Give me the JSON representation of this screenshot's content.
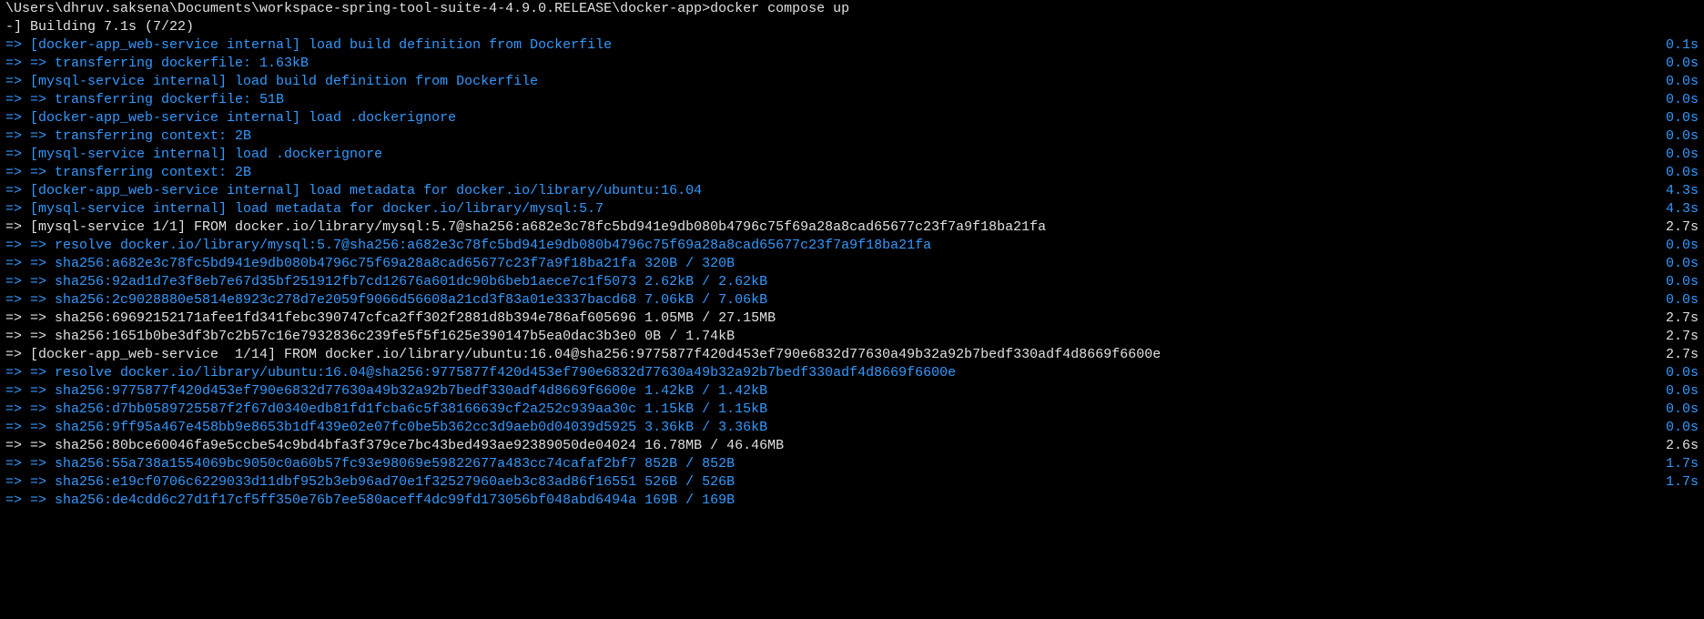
{
  "prompt_line": "\\Users\\dhruv.saksena\\Documents\\workspace-spring-tool-suite-4-4.9.0.RELEASE\\docker-app>docker compose up",
  "building_line": "-] Building 7.1s (7/22)",
  "lines": [
    {
      "color": "blue",
      "left": "=> [docker-app_web-service internal] load build definition from Dockerfile",
      "right": "0.1s"
    },
    {
      "color": "blue",
      "left": "=> => transferring dockerfile: 1.63kB",
      "right": "0.0s"
    },
    {
      "color": "blue",
      "left": "=> [mysql-service internal] load build definition from Dockerfile",
      "right": "0.0s"
    },
    {
      "color": "blue",
      "left": "=> => transferring dockerfile: 51B",
      "right": "0.0s"
    },
    {
      "color": "blue",
      "left": "=> [docker-app_web-service internal] load .dockerignore",
      "right": "0.0s"
    },
    {
      "color": "blue",
      "left": "=> => transferring context: 2B",
      "right": "0.0s"
    },
    {
      "color": "blue",
      "left": "=> [mysql-service internal] load .dockerignore",
      "right": "0.0s"
    },
    {
      "color": "blue",
      "left": "=> => transferring context: 2B",
      "right": "0.0s"
    },
    {
      "color": "blue",
      "left": "=> [docker-app_web-service internal] load metadata for docker.io/library/ubuntu:16.04",
      "right": "4.3s"
    },
    {
      "color": "blue",
      "left": "=> [mysql-service internal] load metadata for docker.io/library/mysql:5.7",
      "right": "4.3s"
    },
    {
      "color": "white",
      "left": "=> [mysql-service 1/1] FROM docker.io/library/mysql:5.7@sha256:a682e3c78fc5bd941e9db080b4796c75f69a28a8cad65677c23f7a9f18ba21fa",
      "right": "2.7s"
    },
    {
      "color": "blue",
      "left": "=> => resolve docker.io/library/mysql:5.7@sha256:a682e3c78fc5bd941e9db080b4796c75f69a28a8cad65677c23f7a9f18ba21fa",
      "right": "0.0s"
    },
    {
      "color": "blue",
      "left": "=> => sha256:a682e3c78fc5bd941e9db080b4796c75f69a28a8cad65677c23f7a9f18ba21fa 320B / 320B",
      "right": "0.0s"
    },
    {
      "color": "blue",
      "left": "=> => sha256:92ad1d7e3f8eb7e67d35bf251912fb7cd12676a601dc90b6beb1aece7c1f5073 2.62kB / 2.62kB",
      "right": "0.0s"
    },
    {
      "color": "blue",
      "left": "=> => sha256:2c9028880e5814e8923c278d7e2059f9066d56608a21cd3f83a01e3337bacd68 7.06kB / 7.06kB",
      "right": "0.0s"
    },
    {
      "color": "white",
      "left": "=> => sha256:69692152171afee1fd341febc390747cfca2ff302f2881d8b394e786af605696 1.05MB / 27.15MB",
      "right": "2.7s"
    },
    {
      "color": "white",
      "left": "=> => sha256:1651b0be3df3b7c2b57c16e7932836c239fe5f5f1625e390147b5ea0dac3b3e0 0B / 1.74kB",
      "right": "2.7s"
    },
    {
      "color": "white",
      "left": "=> [docker-app_web-service  1/14] FROM docker.io/library/ubuntu:16.04@sha256:9775877f420d453ef790e6832d77630a49b32a92b7bedf330adf4d8669f6600e",
      "right": "2.7s"
    },
    {
      "color": "blue",
      "left": "=> => resolve docker.io/library/ubuntu:16.04@sha256:9775877f420d453ef790e6832d77630a49b32a92b7bedf330adf4d8669f6600e",
      "right": "0.0s"
    },
    {
      "color": "blue",
      "left": "=> => sha256:9775877f420d453ef790e6832d77630a49b32a92b7bedf330adf4d8669f6600e 1.42kB / 1.42kB",
      "right": "0.0s"
    },
    {
      "color": "blue",
      "left": "=> => sha256:d7bb0589725587f2f67d0340edb81fd1fcba6c5f38166639cf2a252c939aa30c 1.15kB / 1.15kB",
      "right": "0.0s"
    },
    {
      "color": "blue",
      "left": "=> => sha256:9ff95a467e458bb9e8653b1df439e02e07fc0be5b362cc3d9aeb0d04039d5925 3.36kB / 3.36kB",
      "right": "0.0s"
    },
    {
      "color": "white",
      "left": "=> => sha256:80bce60046fa9e5ccbe54c9bd4bfa3f379ce7bc43bed493ae92389050de04024 16.78MB / 46.46MB",
      "right": "2.6s"
    },
    {
      "color": "blue",
      "left": "=> => sha256:55a738a1554069bc9050c0a60b57fc93e98069e59822677a483cc74cafaf2bf7 852B / 852B",
      "right": "1.7s"
    },
    {
      "color": "blue",
      "left": "=> => sha256:e19cf0706c6229033d11dbf952b3eb96ad70e1f32527960aeb3c83ad86f16551 526B / 526B",
      "right": "1.7s"
    },
    {
      "color": "blue",
      "left": "=> => sha256:de4cdd6c27d1f17cf5ff350e76b7ee580aceff4dc99fd173056bf048abd6494a 169B / 169B",
      "right": ""
    }
  ]
}
